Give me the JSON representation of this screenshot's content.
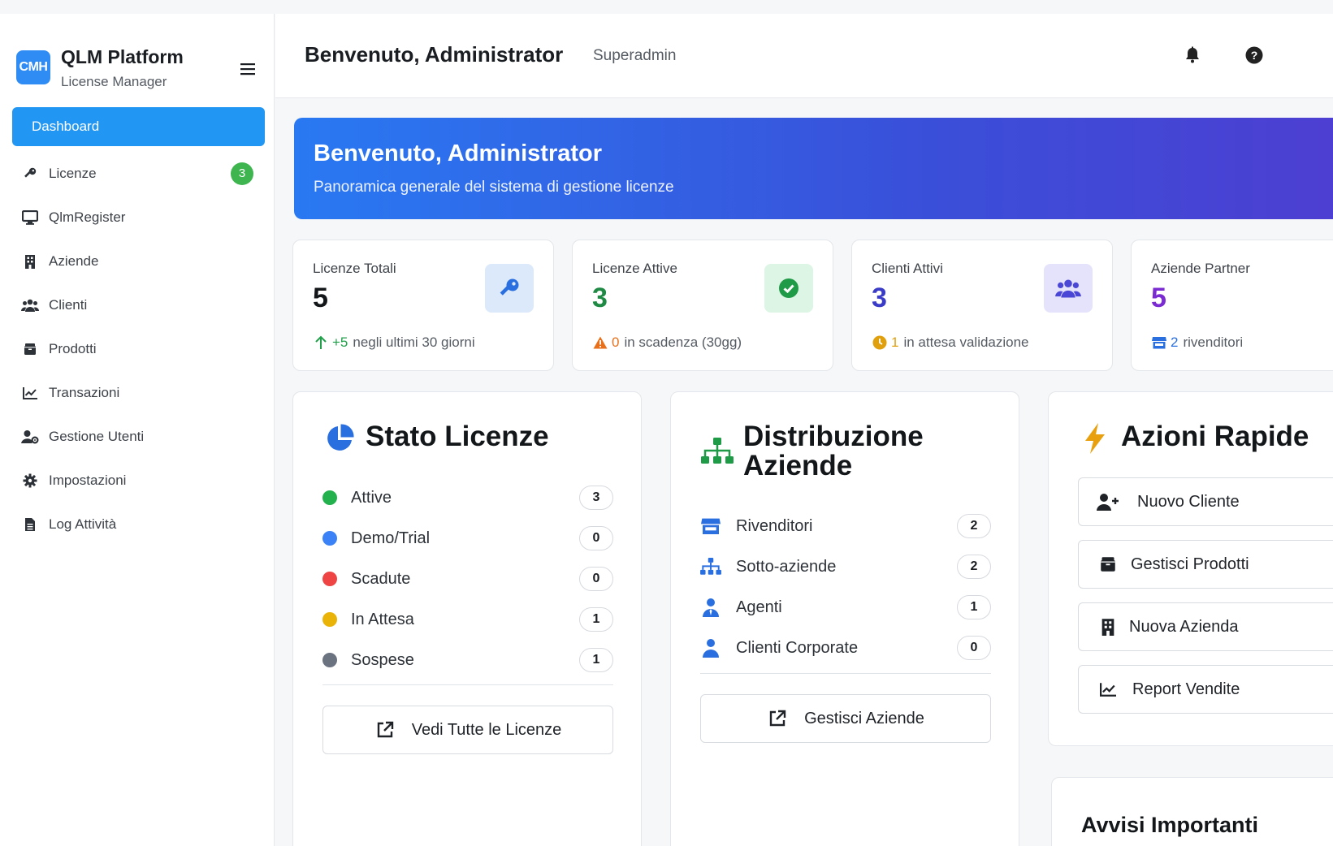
{
  "brand": {
    "logo_text": "CMH",
    "title": "QLM Platform",
    "subtitle": "License Manager"
  },
  "sidebar": {
    "items": [
      {
        "label": "Dashboard",
        "icon": "none",
        "active": true
      },
      {
        "label": "Licenze",
        "icon": "key-icon",
        "badge": "3"
      },
      {
        "label": "QlmRegister",
        "icon": "desktop-icon"
      },
      {
        "label": "Aziende",
        "icon": "building-icon"
      },
      {
        "label": "Clienti",
        "icon": "users-icon"
      },
      {
        "label": "Prodotti",
        "icon": "box-icon"
      },
      {
        "label": "Transazioni",
        "icon": "chart-line-icon"
      },
      {
        "label": "Gestione Utenti",
        "icon": "user-gear-icon"
      },
      {
        "label": "Impostazioni",
        "icon": "gear-icon"
      },
      {
        "label": "Log Attività",
        "icon": "file-icon"
      }
    ]
  },
  "header": {
    "title": "Benvenuto, Administrator",
    "role": "Superadmin"
  },
  "banner": {
    "title": "Benvenuto, Administrator",
    "subtitle": "Panoramica generale del sistema di gestione licenze"
  },
  "stats": [
    {
      "label": "Licenze Totali",
      "value": "5",
      "value_color": "#14171a",
      "foot_num": "+5",
      "foot_text": "negli ultimi 30 giorni",
      "foot_color": "#21a04a",
      "icon": "key-icon",
      "icon_bg": "#dce9fb",
      "icon_color": "#2a6fe0"
    },
    {
      "label": "Licenze Attive",
      "value": "3",
      "value_color": "#1f8a44",
      "foot_num": "0",
      "foot_text": "in scadenza (30gg)",
      "foot_color": "#e8701a",
      "icon": "check-circle-icon",
      "icon_bg": "#dcf5e4",
      "icon_color": "#1f9a47"
    },
    {
      "label": "Clienti Attivi",
      "value": "3",
      "value_color": "#3a3cc7",
      "foot_num": "1",
      "foot_text": "in attesa validazione",
      "foot_color": "#e0a00e",
      "icon": "users-icon",
      "icon_bg": "#e4e3fb",
      "icon_color": "#4b47d6"
    },
    {
      "label": "Aziende Partner",
      "value": "5",
      "value_color": "#7a2bd1",
      "foot_num": "2",
      "foot_text": "rivenditori",
      "foot_color": "#2a6fe0",
      "icon": "store-icon",
      "icon_bg": "#efe3fb",
      "icon_color": "#7a2bd1"
    }
  ],
  "stato": {
    "title": "Stato Licenze",
    "rows": [
      {
        "label": "Attive",
        "count": "3",
        "color": "#22b14c"
      },
      {
        "label": "Demo/Trial",
        "count": "0",
        "color": "#3b82f6"
      },
      {
        "label": "Scadute",
        "count": "0",
        "color": "#ef4444"
      },
      {
        "label": "In Attesa",
        "count": "1",
        "color": "#eab308"
      },
      {
        "label": "Sospese",
        "count": "1",
        "color": "#6b7280"
      }
    ],
    "button": "Vedi Tutte le Licenze"
  },
  "distribuzione": {
    "title_line1": "Distribuzione",
    "title_line2": "Aziende",
    "rows": [
      {
        "label": "Rivenditori",
        "count": "2",
        "icon": "store-icon"
      },
      {
        "label": "Sotto-aziende",
        "count": "2",
        "icon": "sitemap-icon"
      },
      {
        "label": "Agenti",
        "count": "1",
        "icon": "user-tie-icon"
      },
      {
        "label": "Clienti Corporate",
        "count": "0",
        "icon": "user-icon"
      }
    ],
    "button": "Gestisci Aziende"
  },
  "azioni": {
    "title": "Azioni Rapide",
    "buttons": [
      "Nuovo Cliente",
      "Gestisci Prodotti",
      "Nuova Azienda",
      "Report Vendite"
    ]
  },
  "avvisi": {
    "title": "Avvisi Importanti"
  }
}
